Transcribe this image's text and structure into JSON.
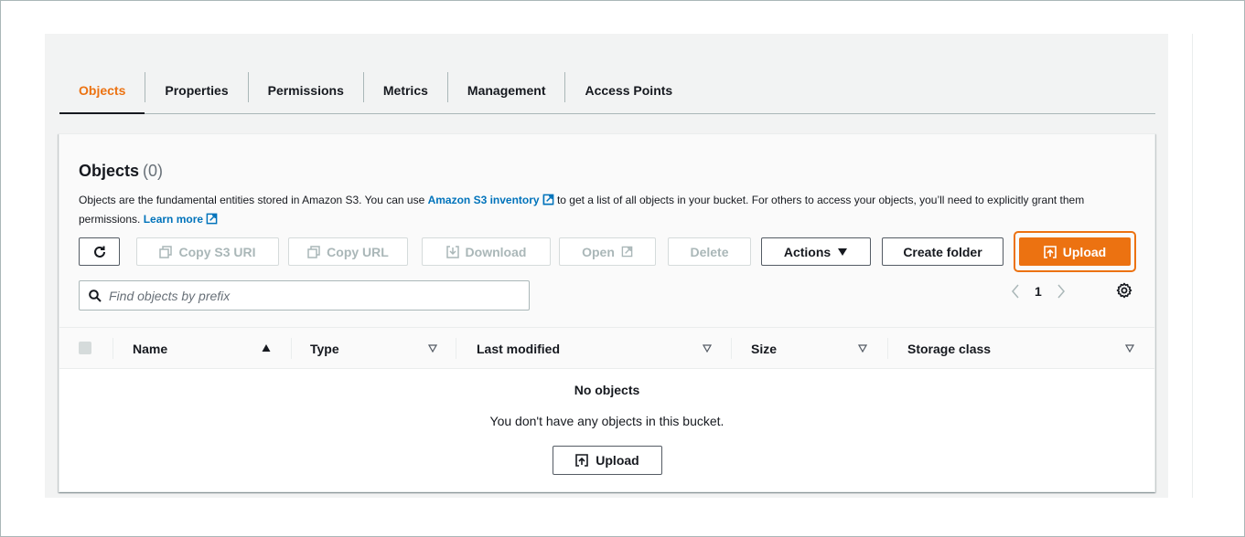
{
  "tabs": [
    {
      "label": "Objects",
      "active": true
    },
    {
      "label": "Properties"
    },
    {
      "label": "Permissions"
    },
    {
      "label": "Metrics"
    },
    {
      "label": "Management"
    },
    {
      "label": "Access Points"
    }
  ],
  "objects_panel": {
    "title": "Objects",
    "count": "(0)",
    "description": {
      "part1": "Objects are the fundamental entities stored in Amazon S3. You can use ",
      "inventory_link": "Amazon S3 inventory",
      "part2": " to get a list of all objects in your bucket. For others to access your objects, you’ll need to explicitly grant them permissions. ",
      "learn_more": "Learn more"
    }
  },
  "toolbar": {
    "copy_s3_uri": "Copy S3 URI",
    "copy_url": "Copy URL",
    "download": "Download",
    "open": "Open",
    "delete": "Delete",
    "actions": "Actions",
    "create_folder": "Create folder",
    "upload": "Upload"
  },
  "search": {
    "placeholder": "Find objects by prefix"
  },
  "pagination": {
    "current_page": "1"
  },
  "table": {
    "columns": [
      "Name",
      "Type",
      "Last modified",
      "Size",
      "Storage class"
    ]
  },
  "empty_state": {
    "title": "No objects",
    "message": "You don't have any objects in this bucket.",
    "upload": "Upload"
  },
  "colors": {
    "accent": "#ec7211",
    "link": "#0073bb",
    "text": "#16191f",
    "disabled": "#aab7b8"
  },
  "icons": [
    "refresh-icon",
    "copy-icon",
    "download-icon",
    "external-link-icon",
    "caret-down-icon",
    "upload-icon",
    "search-icon",
    "chevron-left-icon",
    "chevron-right-icon",
    "gear-icon",
    "sort-ascending-icon",
    "sort-icon"
  ]
}
